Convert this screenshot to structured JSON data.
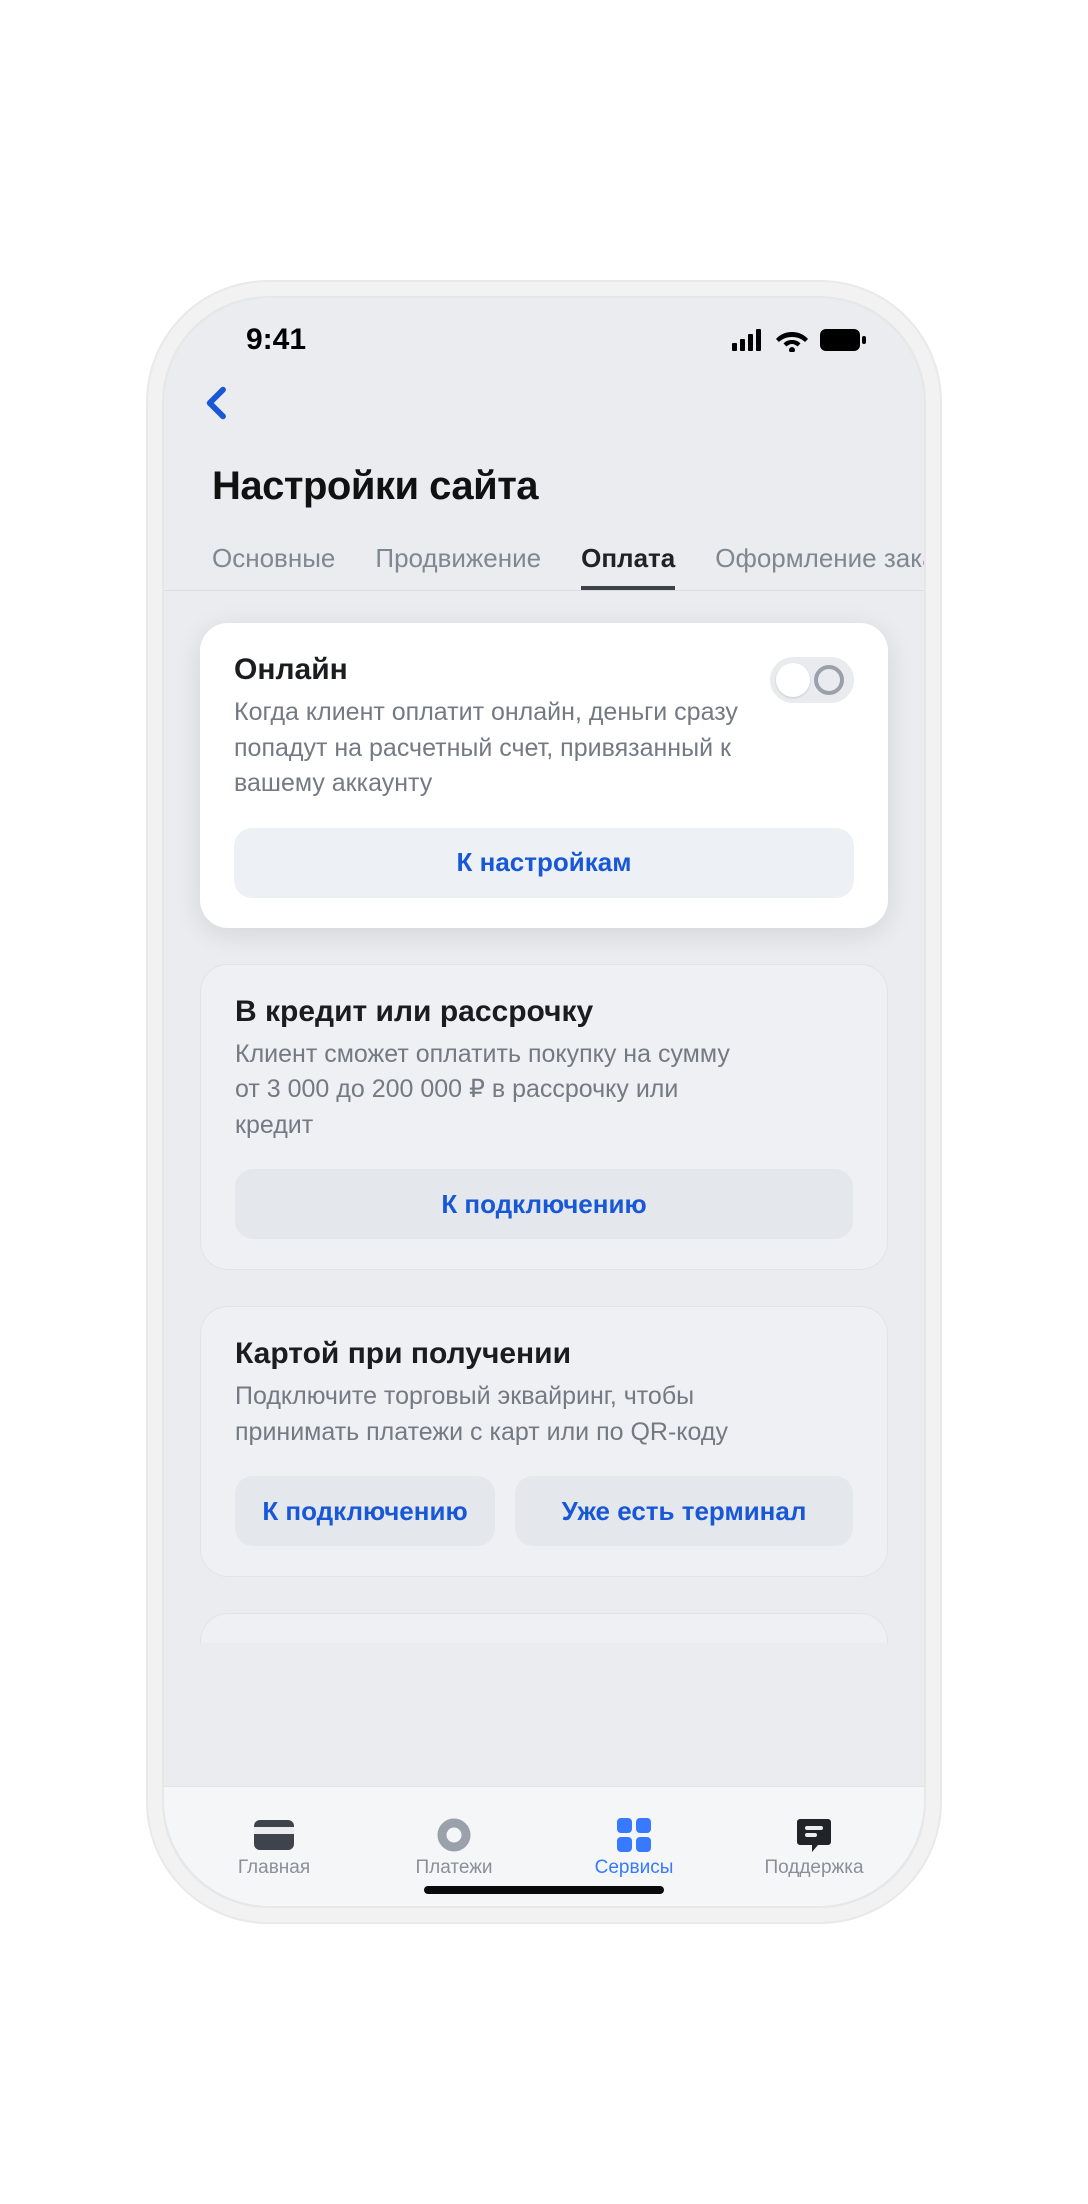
{
  "status": {
    "time": "9:41"
  },
  "page": {
    "title": "Настройки сайта"
  },
  "tabs": [
    {
      "label": "Основные",
      "active": false
    },
    {
      "label": "Продвижение",
      "active": false
    },
    {
      "label": "Оплата",
      "active": true
    },
    {
      "label": "Оформление заказа",
      "active": false
    }
  ],
  "cards": {
    "online": {
      "title": "Онлайн",
      "desc": "Когда клиент оплатит онлайн, деньги сразу попадут на расчетный счет, привязанный к вашему аккаунту",
      "button": "К настройкам"
    },
    "credit": {
      "title": "В кредит или рассрочку",
      "desc": "Клиент сможет оплатить покупку на сумму от 3 000 до 200 000 ₽ в рассрочку или кредит",
      "button": "К подключению"
    },
    "card_on_delivery": {
      "title": "Картой при получении",
      "desc": "Подключите торговый эквайринг, чтобы принимать платежи с карт или по QR-коду",
      "button1": "К подключению",
      "button2": "Уже есть терминал"
    }
  },
  "tabbar": {
    "home": "Главная",
    "payments": "Платежи",
    "services": "Сервисы",
    "support": "Поддержка"
  }
}
